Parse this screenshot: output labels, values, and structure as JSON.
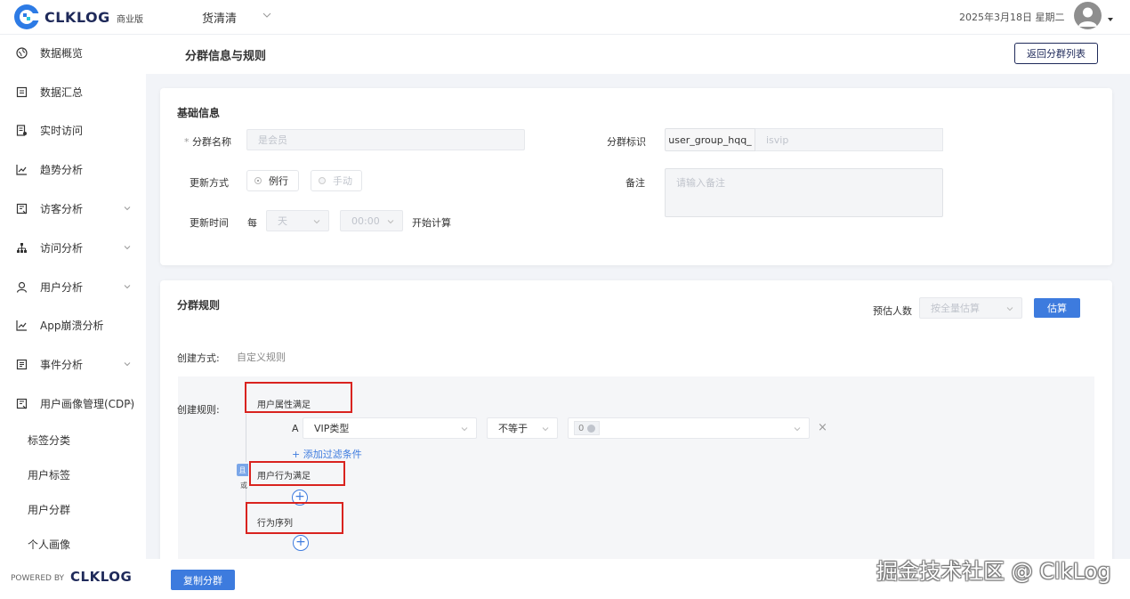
{
  "topbar": {
    "logo_text": "CLKLOG",
    "edition": "商业版",
    "project": "货清清",
    "date": "2025年3月18日 星期二"
  },
  "sidebar": {
    "items": [
      {
        "label": "数据概览",
        "icon": "globe-icon"
      },
      {
        "label": "数据汇总",
        "icon": "summary-icon"
      },
      {
        "label": "实时访问",
        "icon": "realtime-icon"
      },
      {
        "label": "趋势分析",
        "icon": "trend-chart-icon"
      },
      {
        "label": "访客分析",
        "icon": "visitor-icon"
      },
      {
        "label": "访问分析",
        "icon": "sitemap-icon"
      },
      {
        "label": "用户分析",
        "icon": "user-icon"
      },
      {
        "label": "App崩溃分析",
        "icon": "crash-chart-icon"
      },
      {
        "label": "事件分析",
        "icon": "event-icon"
      },
      {
        "label": "用户画像管理(CDP)",
        "icon": "portrait-icon"
      }
    ],
    "sub_items": [
      "标签分类",
      "用户标签",
      "用户分群",
      "个人画像"
    ],
    "powered_by": "POWERED BY",
    "powered_logo": "CLKLOG"
  },
  "header": {
    "title": "分群信息与规则",
    "back_button": "返回分群列表"
  },
  "basic": {
    "title": "基础信息",
    "name_label": "分群名称",
    "name_required": "*",
    "name_value": "是会员",
    "update_mode_label": "更新方式",
    "mode_routine": "例行",
    "mode_manual": "手动",
    "update_time_label": "更新时间",
    "every": "每",
    "period_value": "天",
    "time_value": "00:00",
    "start_calc": "开始计算",
    "id_label": "分群标识",
    "id_prefix": "user_group_hqq_",
    "id_value": "isvip",
    "remark_label": "备注",
    "remark_placeholder": "请输入备注"
  },
  "rules": {
    "title": "分群规则",
    "estimate_label": "预估人数",
    "estimate_select": "按全量估算",
    "estimate_button": "估算",
    "create_mode_label": "创建方式:",
    "create_mode_value": "自定义规则",
    "create_rule_label": "创建规则:",
    "group_attr": "用户属性满足",
    "cond_letter": "A",
    "cond_field": "VIP类型",
    "cond_op": "不等于",
    "cond_value": "0",
    "remove": "×",
    "add_filter": "+ 添加过滤条件",
    "and_label": "且",
    "or_label": "或",
    "group_behavior": "用户行为满足",
    "group_sequence": "行为序列",
    "plus": "+"
  },
  "footer": {
    "copy_button": "复制分群",
    "watermark": "掘金技术社区 @ ClkLog"
  },
  "colors": {
    "primary": "#3d7bde",
    "brand_dark": "#1f2a5a",
    "highlight_red": "#d9231f"
  }
}
